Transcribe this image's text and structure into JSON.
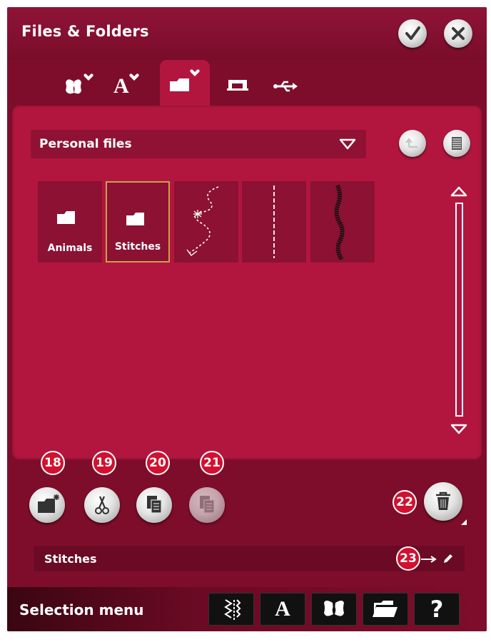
{
  "title": "Files & Folders",
  "header_buttons": {
    "ok_icon": "checkmark-icon",
    "close_icon": "close-icon"
  },
  "tabs": [
    {
      "icon": "favorite-designs-icon"
    },
    {
      "icon": "favorite-fonts-icon"
    },
    {
      "icon": "favorite-folder-icon",
      "active": true
    },
    {
      "icon": "machine-icon"
    },
    {
      "icon": "usb-icon"
    }
  ],
  "location": {
    "label": "Personal files"
  },
  "items": [
    {
      "type": "folder",
      "label": "Animals"
    },
    {
      "type": "folder",
      "label": "Stitches",
      "selected": true
    },
    {
      "type": "stitch",
      "label": ""
    },
    {
      "type": "stitch",
      "label": ""
    },
    {
      "type": "stitch",
      "label": ""
    }
  ],
  "actions": {
    "new_folder_badge": "18",
    "cut_badge": "19",
    "copy_badge": "20",
    "paste_badge": "21",
    "delete_badge": "22",
    "rename_badge": "23"
  },
  "selected_name": "Stitches",
  "footer": {
    "label": "Selection menu",
    "font_button": "A",
    "help_button": "?"
  },
  "colors": {
    "background": "#7e0d2b",
    "panel": "#b2163f",
    "badge": "#d1112f",
    "selection_border": "#c8a24a"
  }
}
